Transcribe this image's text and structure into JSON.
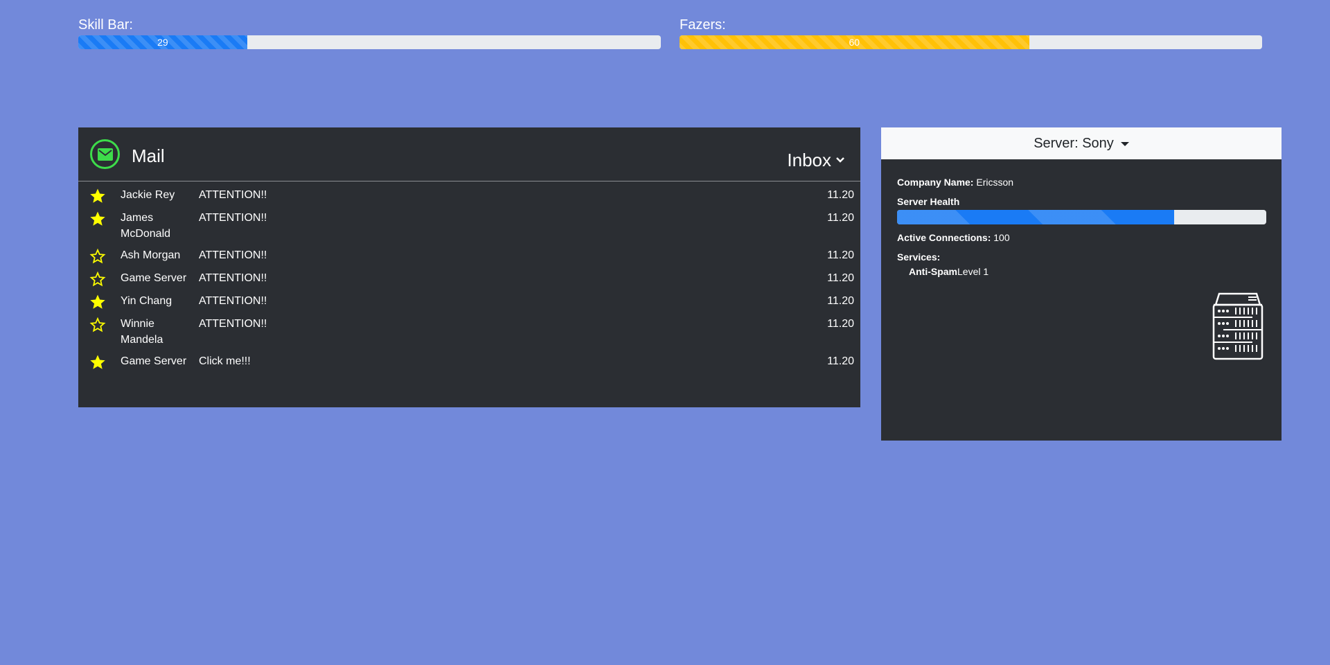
{
  "bars": [
    {
      "label": "Skill Bar:",
      "value": 29,
      "text": "29",
      "color": "#1a7bf5"
    },
    {
      "label": "Fazers:",
      "value": 60,
      "text": "60",
      "color": "#ffc107"
    }
  ],
  "mail": {
    "title": "Mail",
    "folder": "Inbox",
    "icon": "envelope-icon",
    "accent": "#3ddc4a",
    "messages": [
      {
        "starred": true,
        "sender": "Jackie Rey",
        "subject": "ATTENTION!!",
        "time": "11.20"
      },
      {
        "starred": true,
        "sender": "James McDonald",
        "subject": "ATTENTION!!",
        "time": "11.20"
      },
      {
        "starred": false,
        "sender": "Ash Morgan",
        "subject": "ATTENTION!!",
        "time": "11.20"
      },
      {
        "starred": false,
        "sender": "Game Server",
        "subject": "ATTENTION!!",
        "time": "11.20"
      },
      {
        "starred": true,
        "sender": "Yin Chang",
        "subject": "ATTENTION!!",
        "time": "11.20"
      },
      {
        "starred": false,
        "sender": "Winnie Mandela",
        "subject": "ATTENTION!!",
        "time": "11.20"
      },
      {
        "starred": true,
        "sender": "Game Server",
        "subject": "Click me!!!",
        "time": "11.20"
      }
    ]
  },
  "server": {
    "header": "Server: Sony",
    "company_label": "Company Name:",
    "company_value": "Ericsson",
    "health_label": "Server Health",
    "health_value": 75,
    "connections_label": "Active Connections:",
    "connections_value": "100",
    "services_label": "Services:",
    "services": [
      {
        "name": "Anti-Spam",
        "level": "Level 1"
      }
    ],
    "icon": "server-rack-icon"
  },
  "colors": {
    "background": "#7289da",
    "panel": "#2b2e33",
    "star": "#ffff00"
  }
}
